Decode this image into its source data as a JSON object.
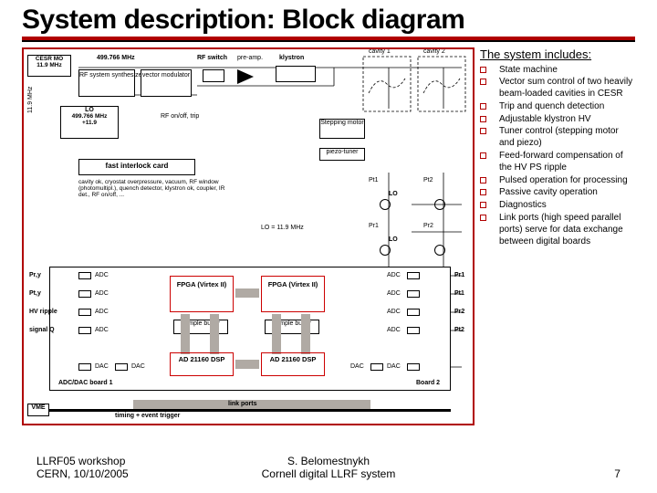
{
  "title": "System description: Block diagram",
  "subheading": "The system includes:",
  "bullets": [
    "State machine",
    "Vector sum control of two heavily beam-loaded cavities in CESR",
    "Trip and quench detection",
    "Adjustable klystron HV",
    "Tuner control (stepping motor and piezo)",
    "Feed-forward compensation of the HV PS ripple",
    "Pulsed operation for processing",
    "Passive cavity operation",
    "Diagnostics",
    "Link ports (high speed parallel ports) serve for data exchange between digital boards"
  ],
  "footer": {
    "left_line1": "LLRF05 workshop",
    "left_line2": "CERN, 10/10/2005",
    "center_line1": "S. Belomestnykh",
    "center_line2": "Cornell digital LLRF system",
    "right": "7"
  },
  "diagram": {
    "top_left_box_l1": "CESR MO",
    "top_left_box_l2": "11.9 MHz",
    "freq_top": "499.766 MHz",
    "rf_synth": "RF system synthesizer",
    "vec_mod": "vector modulator",
    "rf_switch": "RF switch",
    "preamp": "pre-amp.",
    "klystron": "klystron",
    "cavity1": "cavity 1",
    "cavity2": "cavity 2",
    "lo_box_l1": "LO",
    "lo_box_l2": "499.766 MHz",
    "lo_box_l3": "+11.9",
    "lo_note": "LO = 11.9 MHz",
    "rf_onoff": "RF on/off, trip",
    "interlock": "fast interlock card",
    "interlock_note": "cavity ok, cryostat overpressure, vacuum, RF window (photomultipl.), quench detector, klystron ok, coupler, IR det., RF on/off, ...",
    "stepping_motor": "Stepping motor",
    "piezo": "piezo-tuner",
    "lo_small": "LO",
    "pt1": "Pt1",
    "pt2": "Pt2",
    "pr1": "Pr1",
    "pr2": "Pr2",
    "p_ry": "Pr,y",
    "p_ty": "Pt,y",
    "hv_ripple": "HV ripple",
    "signal_q": "signal Q",
    "adc": "ADC",
    "dac": "DAC",
    "fpga1": "FPGA (Virtex II)",
    "fpga2": "FPGA (Virtex II)",
    "sample_buffer": "sample buffer",
    "dsp1": "AD 21160 DSP",
    "dsp2": "AD 21160 DSP",
    "board1": "ADC/DAC board 1",
    "board2": "Board 2",
    "link_ports": "link ports",
    "timing": "timing + event trigger",
    "vme": "VME"
  }
}
